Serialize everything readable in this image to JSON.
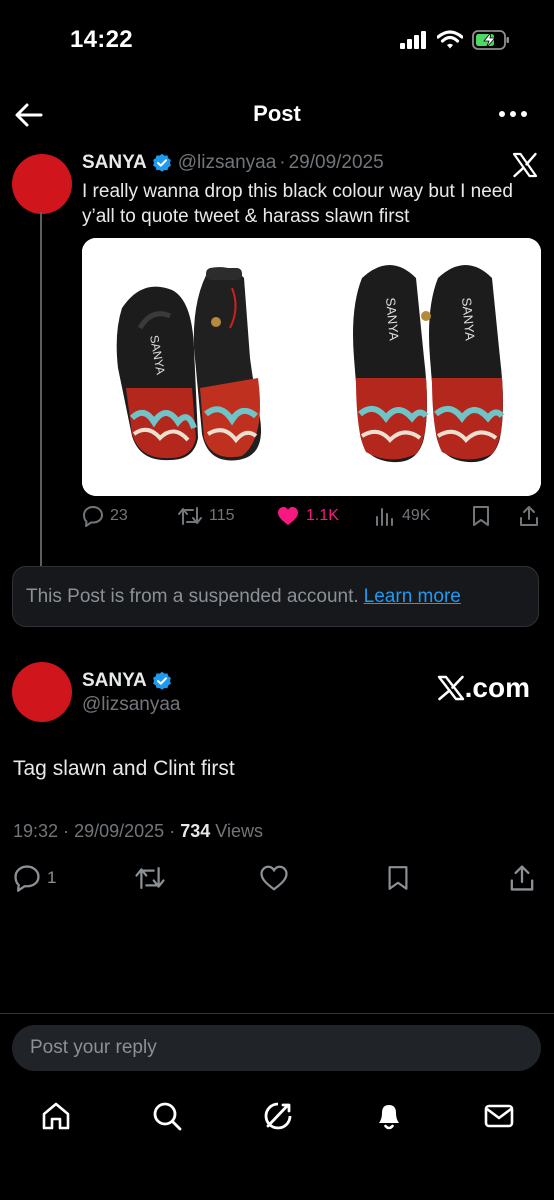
{
  "status_bar": {
    "time": "14:22",
    "signal_icon": "cellular-signal-icon",
    "wifi_icon": "wifi-icon",
    "battery_icon": "battery-charging-icon",
    "battery_color": "#4cd964"
  },
  "header": {
    "title": "Post",
    "back_icon": "back-arrow-icon",
    "more_icon": "more-dots-icon"
  },
  "quoted_post": {
    "name": "SANYA",
    "handle": "@lizsanyaa",
    "separator": "·",
    "date": "29/09/2025",
    "text": "I really wanna drop this black colour way but I need y’all to quote tweet & harass slawn first",
    "avatar_color": "#d0151c",
    "verified_color": "#1d9bf0",
    "images": [
      "black-graffiti-clog-pair-side",
      "black-graffiti-clog-pair-top"
    ],
    "actions": {
      "replies": "23",
      "reposts": "115",
      "likes": "1.1K",
      "views": "49K",
      "like_color": "#f91880"
    }
  },
  "suspended_notice": {
    "text": "This Post is from a suspended account.",
    "link": "Learn more"
  },
  "main_post": {
    "name": "SANYA",
    "handle": "@lizsanyaa",
    "brand": ".com",
    "text": "Tag slawn and Clint first",
    "time": "19:32",
    "sep1": "·",
    "date": "29/09/2025",
    "sep2": "·",
    "views_count": "734",
    "views_label": "Views",
    "actions": {
      "replies": "1"
    }
  },
  "reply_bar": {
    "placeholder": "Post your reply"
  },
  "bottom_nav": [
    "home-icon",
    "search-icon",
    "grok-icon",
    "notifications-icon",
    "messages-icon"
  ]
}
